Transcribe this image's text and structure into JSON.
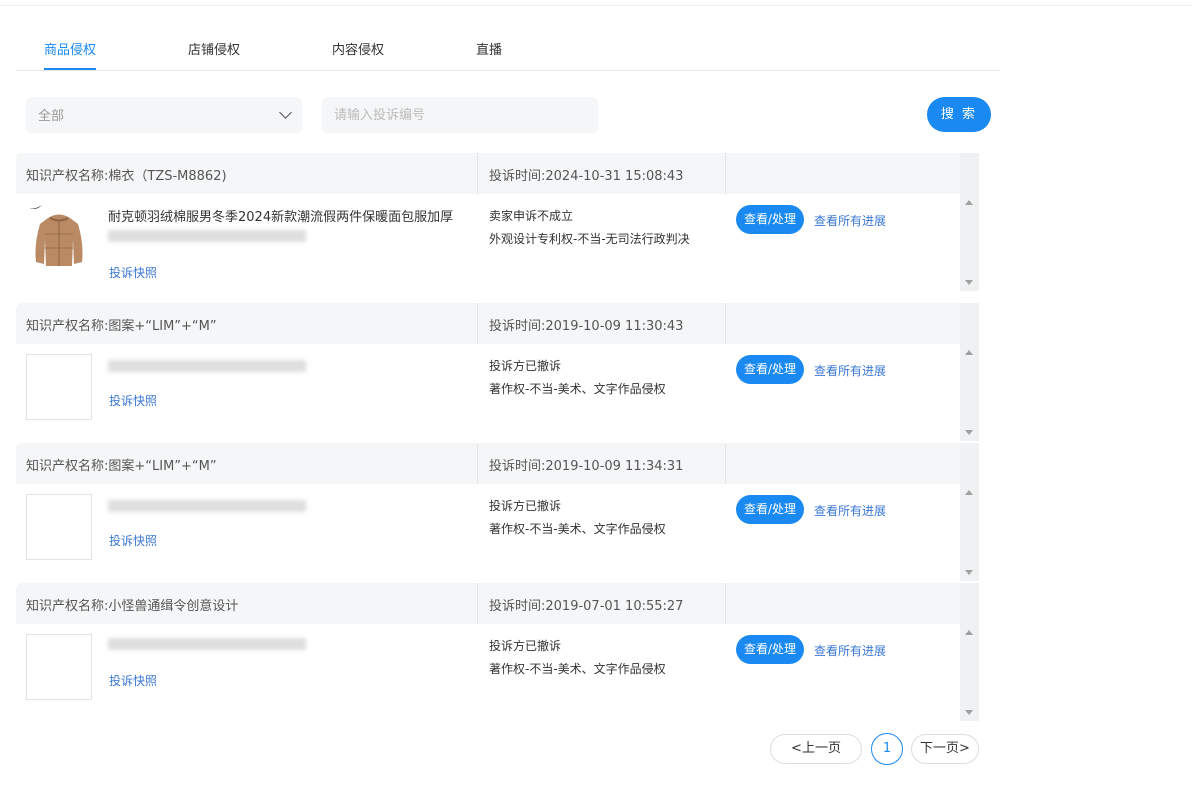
{
  "tabs": [
    {
      "label": "商品侵权",
      "active": true
    },
    {
      "label": "店铺侵权",
      "active": false
    },
    {
      "label": "内容侵权",
      "active": false
    },
    {
      "label": "直播",
      "active": false
    }
  ],
  "filter": {
    "select_value": "全部",
    "search_placeholder": "请输入投诉编号",
    "search_button": "搜 索"
  },
  "records": [
    {
      "ip_name": "知识产权名称:棉衣（TZS-M8862)",
      "complaint_time": "投诉时间:2024-10-31 15:08:43",
      "product_title": "耐克顿羽绒棉服男冬季2024新款潮流假两件保暖面包服加厚",
      "snapshot_link": "投诉快照",
      "status": "卖家申诉不成立",
      "reason": "外观设计专利权-不当-无司法行政判决",
      "handle_button": "查看/处理",
      "progress_link": "查看所有进展"
    },
    {
      "ip_name": "知识产权名称:图案+“LIM”+“M”",
      "complaint_time": "投诉时间:2019-10-09 11:30:43",
      "snapshot_link": "投诉快照",
      "status": "投诉方已撤诉",
      "reason": "著作权-不当-美术、文字作品侵权",
      "handle_button": "查看/处理",
      "progress_link": "查看所有进展"
    },
    {
      "ip_name": "知识产权名称:图案+“LIM”+“M”",
      "complaint_time": "投诉时间:2019-10-09 11:34:31",
      "snapshot_link": "投诉快照",
      "status": "投诉方已撤诉",
      "reason": "著作权-不当-美术、文字作品侵权",
      "handle_button": "查看/处理",
      "progress_link": "查看所有进展"
    },
    {
      "ip_name": "知识产权名称:小怪兽通缉令创意设计",
      "complaint_time": "投诉时间:2019-07-01 10:55:27",
      "snapshot_link": "投诉快照",
      "status": "投诉方已撤诉",
      "reason": "著作权-不当-美术、文字作品侵权",
      "handle_button": "查看/处理",
      "progress_link": "查看所有进展"
    }
  ],
  "pagination": {
    "prev": "<上一页",
    "current": "1",
    "next": "下一页>"
  },
  "colors": {
    "accent": "#1a89f1",
    "link": "#3a77d6",
    "header_bg": "#f5f6f7"
  }
}
